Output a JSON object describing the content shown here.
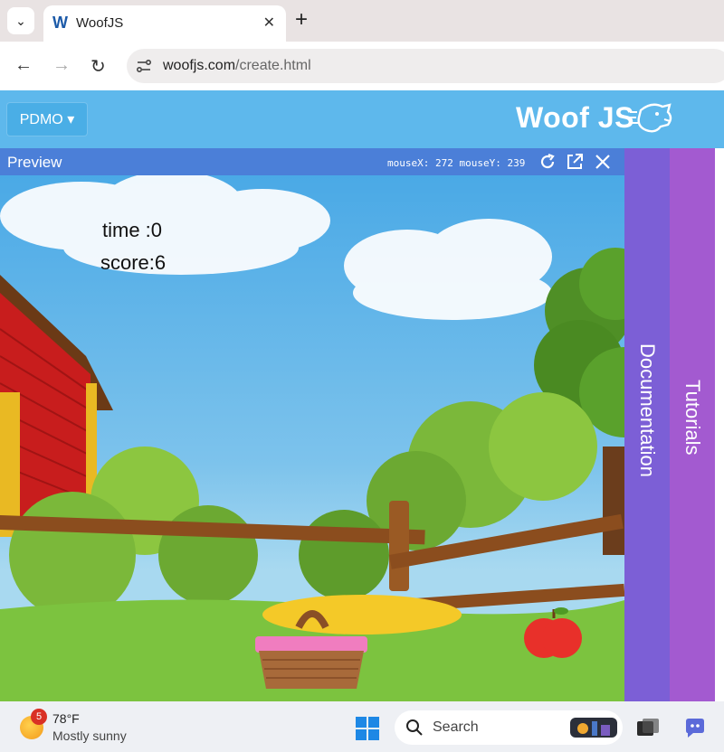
{
  "browser": {
    "tab_logo": "W",
    "tab_title": "WoofJS",
    "tab_close": "✕",
    "new_tab": "+",
    "url_domain": "woofjs.com",
    "url_path": "/create.html"
  },
  "header": {
    "project_button": "PDMO ▾",
    "logo_text": "Woof JS"
  },
  "preview": {
    "label": "Preview",
    "mouse_readout": "mouseX: 272 mouseY: 239"
  },
  "game": {
    "time_text": "time :0",
    "score_text": "score:6"
  },
  "side_tabs": {
    "documentation": "Documentation",
    "tutorials": "Tutorials"
  },
  "taskbar": {
    "weather_badge": "5",
    "weather_temp": "78°F",
    "weather_desc": "Mostly sunny",
    "search_placeholder": "Search"
  },
  "colors": {
    "header_bg": "#5eb8ec",
    "preview_bar": "#4b7fd8",
    "documentation_tab": "#7c5fd6",
    "tutorials_tab": "#a35ad0"
  }
}
